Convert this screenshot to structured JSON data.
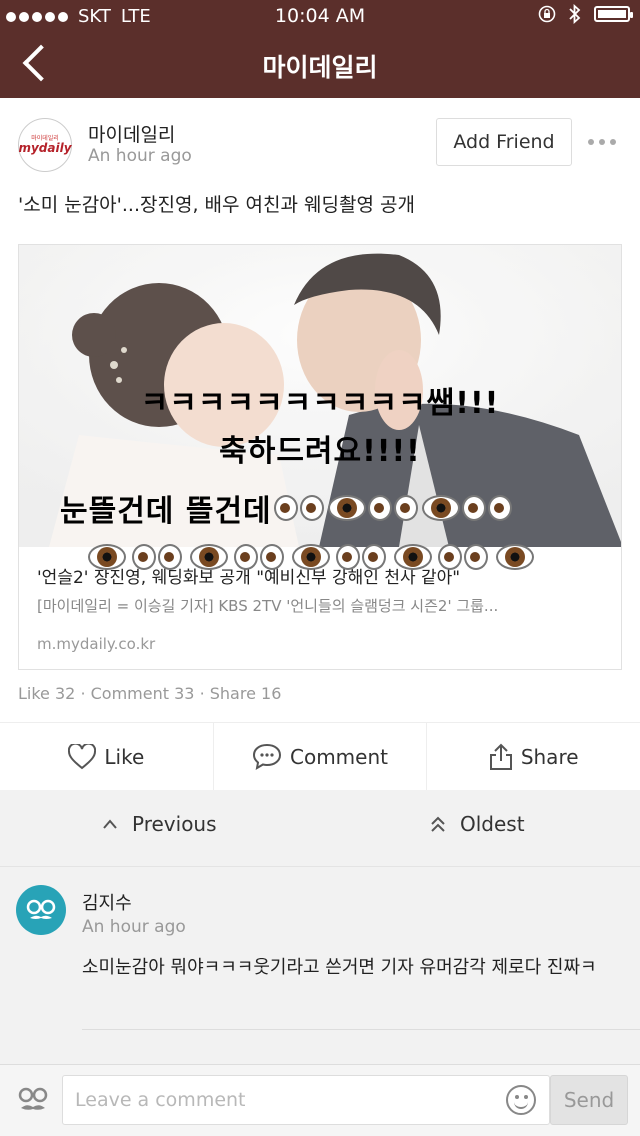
{
  "status": {
    "signal": "●●●●●",
    "carrier": "SKT",
    "network": "LTE",
    "time": "10:04 AM"
  },
  "nav": {
    "title": "마이데일리"
  },
  "post": {
    "author": {
      "logo_small": "마이데일리",
      "logo_big": "mydaily",
      "name": "마이데일리",
      "time": "An hour ago"
    },
    "add_friend_label": "Add Friend",
    "text": "'소미 눈감아'...장진영, 배우 여친과 웨딩촬영 공개",
    "link": {
      "title": "'언슬2' 장진영, 웨딩화보 공개 \"예비신부 강해인 천사 같아\"",
      "description": "[마이데일리 = 이승길 기자] KBS 2TV '언니들의 슬램덩크 시즌2' 그룹...",
      "domain": "m.mydaily.co.kr"
    },
    "overlay": {
      "line1": "ㅋㅋㅋㅋㅋㅋㅋㅋㅋㅋ쌤!!!",
      "line2": "축하드려요!!!!",
      "line3": "눈뜰건데 뜰건데"
    },
    "stats": {
      "likes": "Like 32",
      "comments": "Comment 33",
      "shares": "Share 16",
      "sep": "·"
    },
    "actions": {
      "like": "Like",
      "comment": "Comment",
      "share": "Share"
    }
  },
  "pager": {
    "previous": "Previous",
    "oldest": "Oldest"
  },
  "comment": {
    "name": "김지수",
    "time": "An hour ago",
    "body": "소미눈감아 뭐야ㅋㅋㅋ웃기라고 쓴거면 기자 유머감각 제로다 진짜ㅋ"
  },
  "composer": {
    "placeholder": "Leave a comment",
    "send_label": "Send"
  },
  "colors": {
    "header": "#5b2f2b",
    "avatar_teal": "#28a3b7"
  }
}
